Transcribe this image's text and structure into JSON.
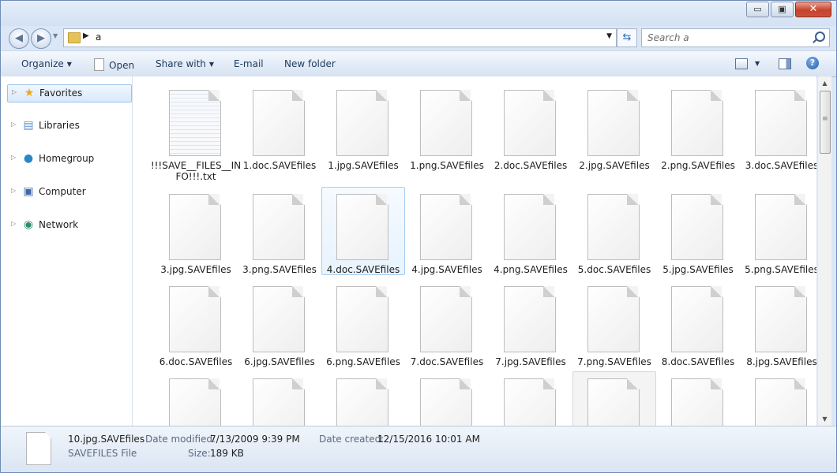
{
  "window": {
    "caption_buttons": {
      "minimize": "▭",
      "maximize": "▣",
      "close": "✕"
    }
  },
  "address": {
    "path": "a",
    "search_placeholder": "Search a"
  },
  "toolbar": {
    "organize": "Organize",
    "open": "Open",
    "share_with": "Share with",
    "email": "E-mail",
    "new_folder": "New folder",
    "help": "?"
  },
  "nav": {
    "items": [
      {
        "label": "Favorites",
        "icon": "star-icon",
        "glyph": "★",
        "selected": true
      },
      {
        "label": "Libraries",
        "icon": "libraries-icon",
        "glyph": "▤",
        "selected": false
      },
      {
        "label": "Homegroup",
        "icon": "homegroup-icon",
        "glyph": "●",
        "selected": false
      },
      {
        "label": "Computer",
        "icon": "computer-icon",
        "glyph": "▣",
        "selected": false
      },
      {
        "label": "Network",
        "icon": "network-icon",
        "glyph": "◉",
        "selected": false
      }
    ]
  },
  "files": [
    "!!!SAVE__FILES__INFO!!!.txt",
    "1.doc.SAVEfiles",
    "1.jpg.SAVEfiles",
    "1.png.SAVEfiles",
    "2.doc.SAVEfiles",
    "2.jpg.SAVEfiles",
    "2.png.SAVEfiles",
    "3.doc.SAVEfiles",
    "3.jpg.SAVEfiles",
    "3.png.SAVEfiles",
    "4.doc.SAVEfiles",
    "4.jpg.SAVEfiles",
    "4.png.SAVEfiles",
    "5.doc.SAVEfiles",
    "5.jpg.SAVEfiles",
    "5.png.SAVEfiles",
    "6.doc.SAVEfiles",
    "6.jpg.SAVEfiles",
    "6.png.SAVEfiles",
    "7.doc.SAVEfiles",
    "7.jpg.SAVEfiles",
    "7.png.SAVEfiles",
    "8.doc.SAVEfiles",
    "8.jpg.SAVEfiles",
    "",
    "",
    "",
    "",
    "",
    "",
    "",
    ""
  ],
  "selected_file": "4.doc.SAVEfiles",
  "details": {
    "filename": "10.jpg.SAVEfiles",
    "filetype": "SAVEFILES File",
    "date_modified_label": "Date modified:",
    "date_modified": "7/13/2009 9:39 PM",
    "size_label": "Size:",
    "size": "189 KB",
    "date_created_label": "Date created:",
    "date_created": "12/15/2016 10:01 AM"
  }
}
